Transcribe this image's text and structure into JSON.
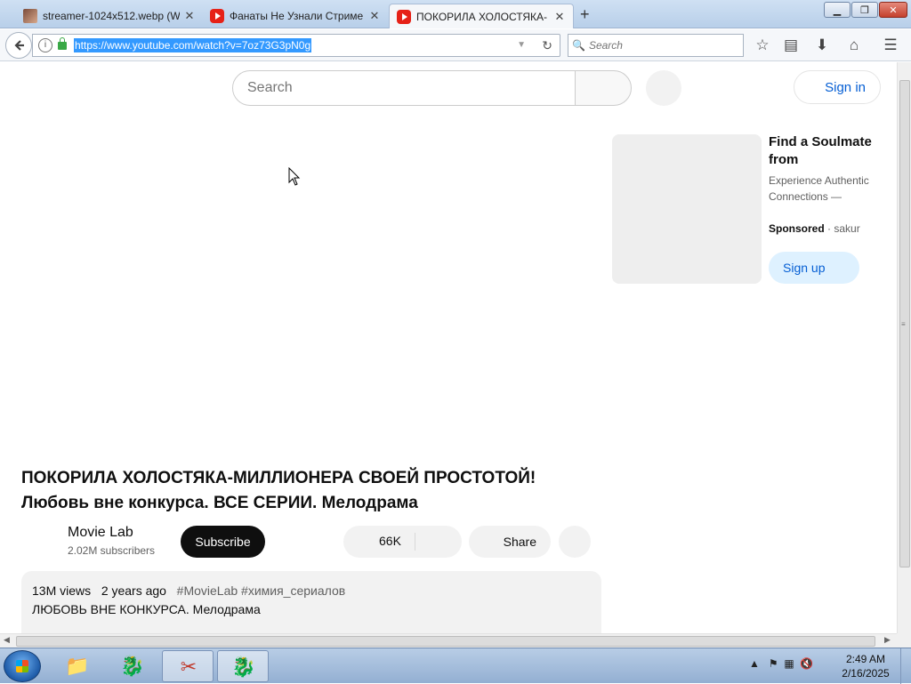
{
  "browser": {
    "tabs": [
      {
        "title": "streamer-1024x512.webp (W",
        "icon": "image-icon",
        "active": false
      },
      {
        "title": "Фанаты Не Узнали Стриме",
        "icon": "youtube-icon",
        "active": false
      },
      {
        "title": "ПОКОРИЛА ХОЛОСТЯКА-",
        "icon": "youtube-icon",
        "active": true
      }
    ],
    "new_tab": "+",
    "tab_close": "✕",
    "window_controls": {
      "minimize": "▁",
      "maximize": "❐",
      "close": "✕"
    },
    "url": "https://www.youtube.com/watch?v=7oz73G3pN0g",
    "search_placeholder": "Search"
  },
  "youtube": {
    "search_placeholder": "Search",
    "sign_in": "Sign in",
    "ad": {
      "title": "Find a Soulmate from",
      "description": "Experience Authentic Connections —",
      "sponsored": "Sponsored",
      "advertiser": "· sakur",
      "cta": "Sign up"
    },
    "video": {
      "title": "ПОКОРИЛА ХОЛОСТЯКА-МИЛЛИОНЕРА СВОЕЙ ПРОСТОТОЙ! Любовь вне конкурса. ВСЕ СЕРИИ. Мелодрама",
      "channel": "Movie Lab",
      "subscribers": "2.02M subscribers",
      "subscribe": "Subscribe",
      "likes": "66K",
      "share": "Share",
      "views": "13M views",
      "age": "2 years ago",
      "tags": "#MovieLab #химия_сериалов",
      "description": "ЛЮБОВЬ ВНЕ КОНКУРСА. Мелодрама"
    }
  },
  "taskbar": {
    "clock_time": "2:49 AM",
    "clock_date": "2/16/2025"
  },
  "colors": {
    "link_blue": "#065fd4",
    "subscribe_bg": "#0f0f0f",
    "url_highlight": "#3399ff"
  }
}
